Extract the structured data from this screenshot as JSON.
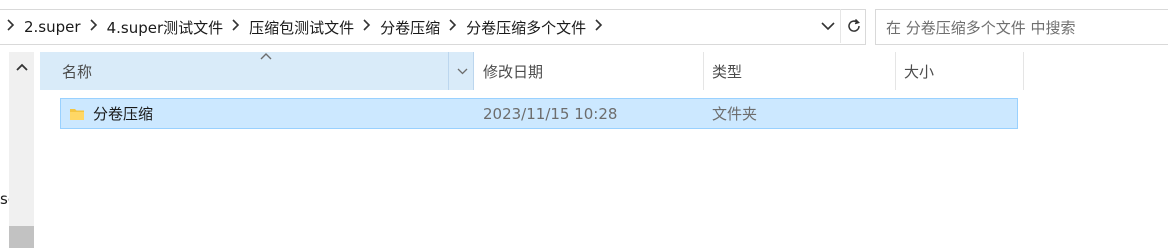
{
  "breadcrumbs": [
    "2.super",
    "4.super测试文件",
    "压缩包测试文件",
    "分卷压缩",
    "分卷压缩多个文件"
  ],
  "search": {
    "placeholder": "在 分卷压缩多个文件 中搜索"
  },
  "nav": {
    "partial_text": "sc"
  },
  "columns": {
    "name": "名称",
    "date": "修改日期",
    "type": "类型",
    "size": "大小"
  },
  "rows": [
    {
      "name": "分卷压缩",
      "date": "2023/11/15 10:28",
      "type": "文件夹",
      "size": "",
      "icon": "folder-icon",
      "selected": true
    }
  ],
  "colors": {
    "selection": "#cce8ff",
    "selection_border": "#99d1ff",
    "header_active": "#d9ebf9",
    "folder": "#f4c542"
  }
}
